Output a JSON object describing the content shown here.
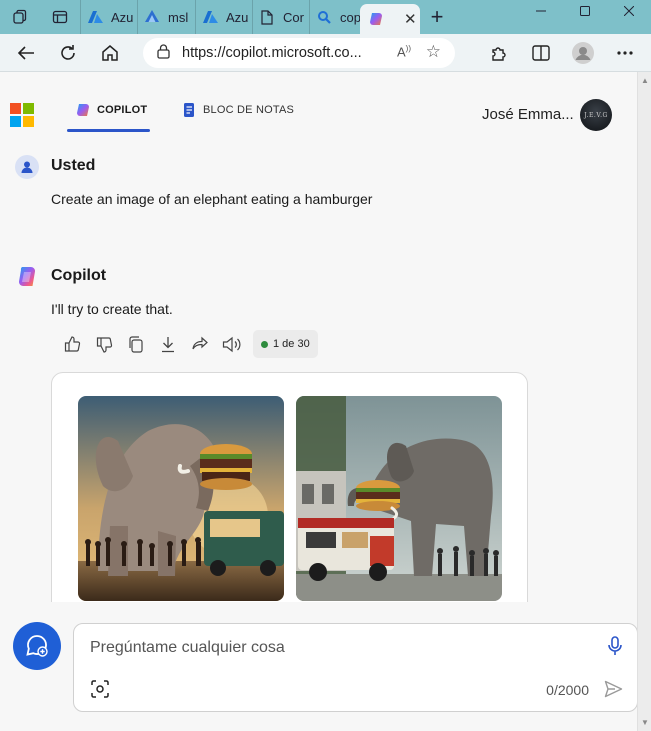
{
  "browser": {
    "tabs": [
      {
        "label": "Azu",
        "icon": "azure-icon"
      },
      {
        "label": "msl",
        "icon": "azure-ml-icon"
      },
      {
        "label": "Azu",
        "icon": "azure-icon"
      },
      {
        "label": "Cor",
        "icon": "document-icon"
      },
      {
        "label": "cop",
        "icon": "bing-search-icon"
      }
    ],
    "active_tab": {
      "icon": "copilot-icon",
      "close": "✕"
    },
    "new_tab": "+",
    "url": "https://copilot.microsoft.co...",
    "colors": {
      "tabstrip": "#7ec0c9",
      "toolbar": "#eef3f5"
    }
  },
  "header": {
    "nav": [
      {
        "label": "COPILOT",
        "icon": "copilot-icon",
        "active": true
      },
      {
        "label": "BLOC DE NOTAS",
        "icon": "notebook-icon",
        "active": false
      }
    ],
    "user_name": "José Emma...",
    "avatar_text": "J.E.V.G"
  },
  "conversation": {
    "user": {
      "author": "Usted",
      "text": "Create an image of an elephant eating a hamburger"
    },
    "assistant": {
      "author": "Copilot",
      "text": "I'll try to create that.",
      "counter": "1 de 30"
    },
    "images": [
      {
        "alt": "elephant eating hamburger near food truck, sunset"
      },
      {
        "alt": "elephant eating hamburger near red food truck"
      }
    ]
  },
  "composer": {
    "placeholder": "Pregúntame cualquier cosa",
    "counter": "0/2000"
  }
}
